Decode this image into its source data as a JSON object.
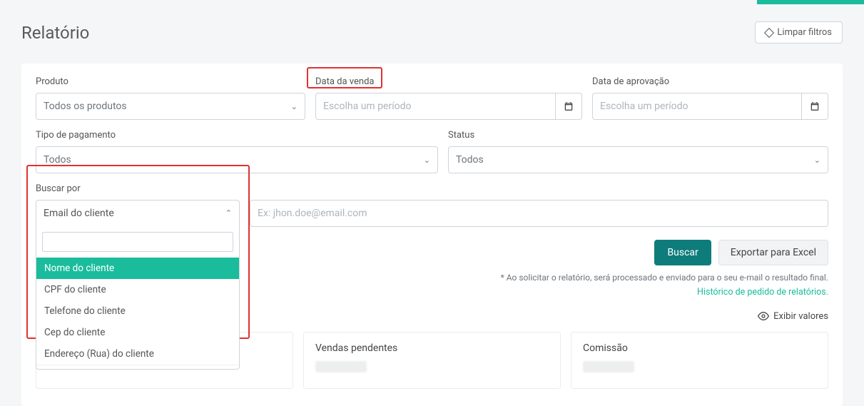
{
  "header": {
    "title": "Relatório",
    "clear_filters": "Limpar filtros"
  },
  "filters": {
    "produto": {
      "label": "Produto",
      "value": "Todos os produtos"
    },
    "data_venda": {
      "label": "Data da venda",
      "placeholder": "Escolha um período"
    },
    "data_aprov": {
      "label": "Data de aprovação",
      "placeholder": "Escolha um período"
    },
    "tipo_pag": {
      "label": "Tipo de pagamento",
      "value": "Todos"
    },
    "status": {
      "label": "Status",
      "value": "Todos"
    },
    "buscar_por": {
      "label": "Buscar por",
      "selected": "Email do cliente"
    },
    "search_placeholder": "Ex: jhon.doe@email.com"
  },
  "dropdown_options": {
    "partial_first": "Email do cliente",
    "items": [
      "Nome do cliente",
      "CPF do cliente",
      "Telefone do cliente",
      "Cep do cliente",
      "Endereço (Rua) do cliente"
    ],
    "highlighted_index": 0
  },
  "actions": {
    "buscar": "Buscar",
    "exportar": "Exportar para Excel"
  },
  "note": "* Ao solicitar o relatório, será processado e enviado para o seu e-mail o resultado final.",
  "link": "Histórico de pedido de relatórios.",
  "exibir": "Exibir valores",
  "cards": [
    {
      "title": ""
    },
    {
      "title": "Vendas pendentes"
    },
    {
      "title": "Comissão"
    }
  ]
}
